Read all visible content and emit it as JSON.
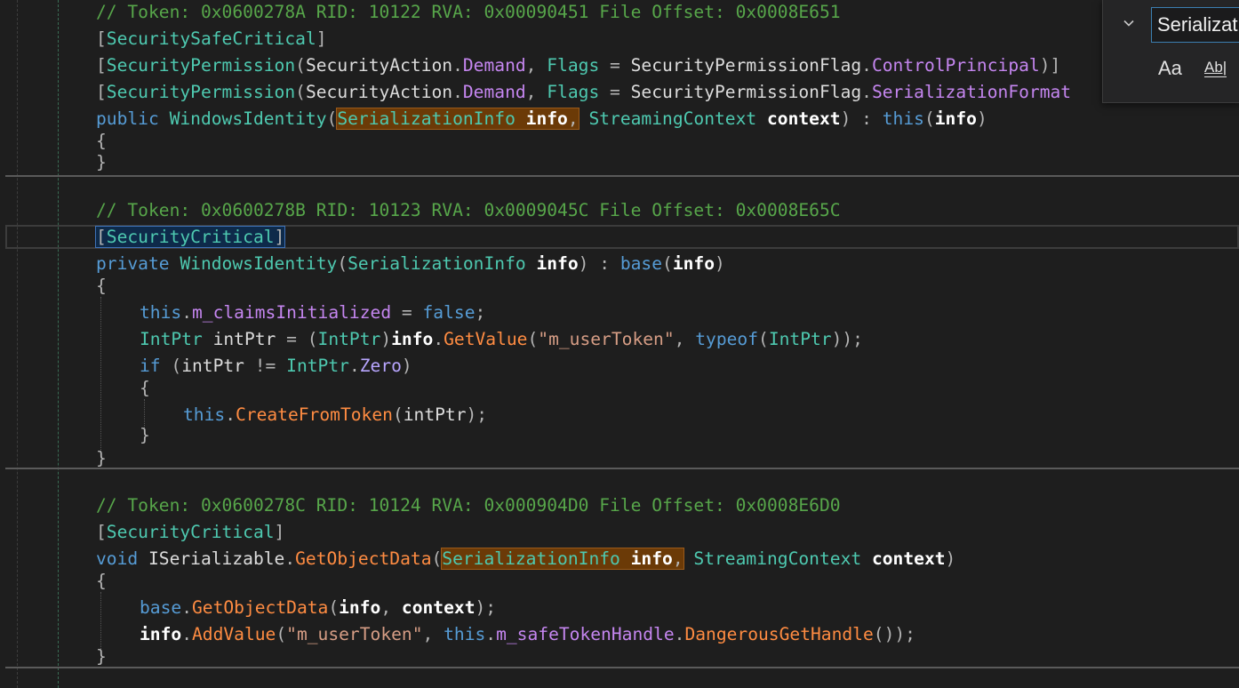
{
  "find": {
    "toggle_icon": "chevron-down-icon",
    "query": "Serializat",
    "match_case_label": "Aa",
    "whole_word_label": "Ab|"
  },
  "code": {
    "m1_comment": "// Token: 0x0600278A RID: 10122 RVA: 0x00090451 File Offset: 0x0008E651",
    "m2_comment": "// Token: 0x0600278B RID: 10123 RVA: 0x0009045C File Offset: 0x0008E65C",
    "m3_comment": "// Token: 0x0600278C RID: 10124 RVA: 0x000904D0 File Offset: 0x0008E6D0",
    "attr_safecritical": "SecuritySafeCritical",
    "attr_securitypermission": "SecurityPermission",
    "securityaction": "SecurityAction",
    "demand": "Demand",
    "flags": "Flags",
    "permflag": "SecurityPermissionFlag",
    "controlprincipal": "ControlPrincipal",
    "serializationformat": "SerializationFormat",
    "attr_critical": "SecurityCritical",
    "kw_public": "public",
    "kw_private": "private",
    "kw_void": "void",
    "kw_this": "this",
    "kw_base": "base",
    "kw_false": "false",
    "kw_if": "if",
    "kw_typeof": "typeof",
    "windowsidentity": "WindowsIdentity",
    "serializationinfo": "SerializationInfo",
    "streamingcontext": "StreamingContext",
    "info": "info",
    "context": "context",
    "m_claimsinitialized": "m_claimsInitialized",
    "intptr_type": "IntPtr",
    "intptr_var": "intPtr",
    "getvalue": "GetValue",
    "str_usertoken": "\"m_userToken\"",
    "zero": "Zero",
    "createfromtoken": "CreateFromToken",
    "iserializable": "ISerializable",
    "getobjectdata": "GetObjectData",
    "addvalue": "AddValue",
    "m_safetokenhandle": "m_safeTokenHandle",
    "dangerousgethandle": "DangerousGetHandle"
  }
}
